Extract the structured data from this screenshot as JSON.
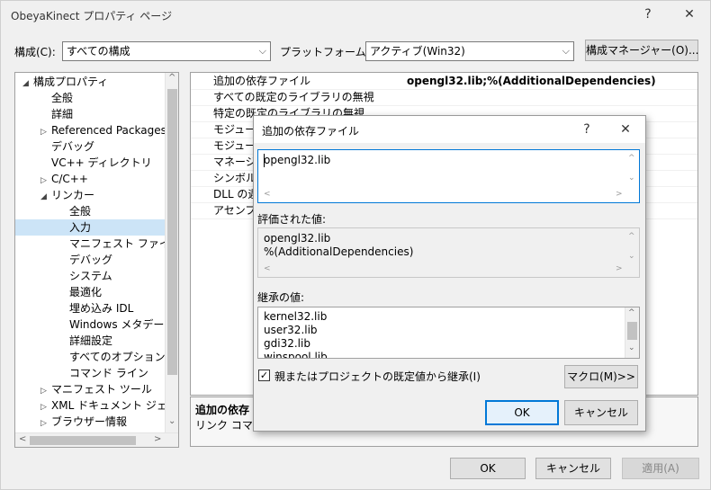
{
  "window": {
    "title": "ObeyaKinect プロパティ ページ",
    "help_glyph": "?",
    "close_glyph": "✕"
  },
  "toolbar": {
    "config_label": "構成(C):",
    "config_value": "すべての構成",
    "platform_label": "プラットフォーム(P):",
    "platform_value": "アクティブ(Win32)",
    "config_manager_label": "構成マネージャー(O)...",
    "dropdown_glyph": "⌵"
  },
  "tree": {
    "items": [
      {
        "label": "構成プロパティ",
        "expander": "◢"
      },
      {
        "label": "全般",
        "expander": ""
      },
      {
        "label": "詳細",
        "expander": ""
      },
      {
        "label": "Referenced Packages",
        "expander": "▷"
      },
      {
        "label": "デバッグ",
        "expander": ""
      },
      {
        "label": "VC++ ディレクトリ",
        "expander": ""
      },
      {
        "label": "C/C++",
        "expander": "▷"
      },
      {
        "label": "リンカー",
        "expander": "◢"
      },
      {
        "label": "全般",
        "expander": ""
      },
      {
        "label": "入力",
        "expander": ""
      },
      {
        "label": "マニフェスト ファイル",
        "expander": ""
      },
      {
        "label": "デバッグ",
        "expander": ""
      },
      {
        "label": "システム",
        "expander": ""
      },
      {
        "label": "最適化",
        "expander": ""
      },
      {
        "label": "埋め込み IDL",
        "expander": ""
      },
      {
        "label": "Windows メタデータ",
        "expander": ""
      },
      {
        "label": "詳細設定",
        "expander": ""
      },
      {
        "label": "すべてのオプション",
        "expander": ""
      },
      {
        "label": "コマンド ライン",
        "expander": ""
      },
      {
        "label": "マニフェスト ツール",
        "expander": "▷"
      },
      {
        "label": "XML ドキュメント ジェネレー",
        "expander": "▷"
      },
      {
        "label": "ブラウザー情報",
        "expander": "▷"
      }
    ],
    "selected_index": 9,
    "scroll_up": "^",
    "scroll_down": "⌄",
    "scroll_left": "<",
    "scroll_right": ">"
  },
  "grid": {
    "rows": [
      {
        "name": "追加の依存ファイル",
        "value": "opengl32.lib;%(AdditionalDependencies)"
      },
      {
        "name": "すべての既定のライブラリの無視",
        "value": ""
      },
      {
        "name": "特定の既定のライブラリの無視",
        "value": ""
      },
      {
        "name": "モジュール",
        "value": ""
      },
      {
        "name": "モジュール",
        "value": ""
      },
      {
        "name": "マネージド",
        "value": ""
      },
      {
        "name": "シンボル参",
        "value": ""
      },
      {
        "name": "DLL の遅",
        "value": ""
      },
      {
        "name": "アセンブリ",
        "value": ""
      }
    ]
  },
  "description": {
    "title": "追加の依存",
    "text": "リンク コマンド"
  },
  "footer": {
    "ok": "OK",
    "cancel": "キャンセル",
    "apply": "適用(A)"
  },
  "dialog": {
    "title": "追加の依存ファイル",
    "help_glyph": "?",
    "close_glyph": "✕",
    "input_value": "opengl32.lib",
    "evaluated_label": "評価された値:",
    "evaluated_lines": [
      "opengl32.lib",
      "%(AdditionalDependencies)"
    ],
    "inherited_label": "継承の値:",
    "inherited_lines": [
      "kernel32.lib",
      "user32.lib",
      "gdi32.lib",
      "winspool.lib"
    ],
    "inherit_checkbox_label": "親またはプロジェクトの既定値から継承(I)",
    "inherit_checked": "✓",
    "macro_button": "マクロ(M)>>",
    "ok": "OK",
    "cancel": "キャンセル"
  }
}
